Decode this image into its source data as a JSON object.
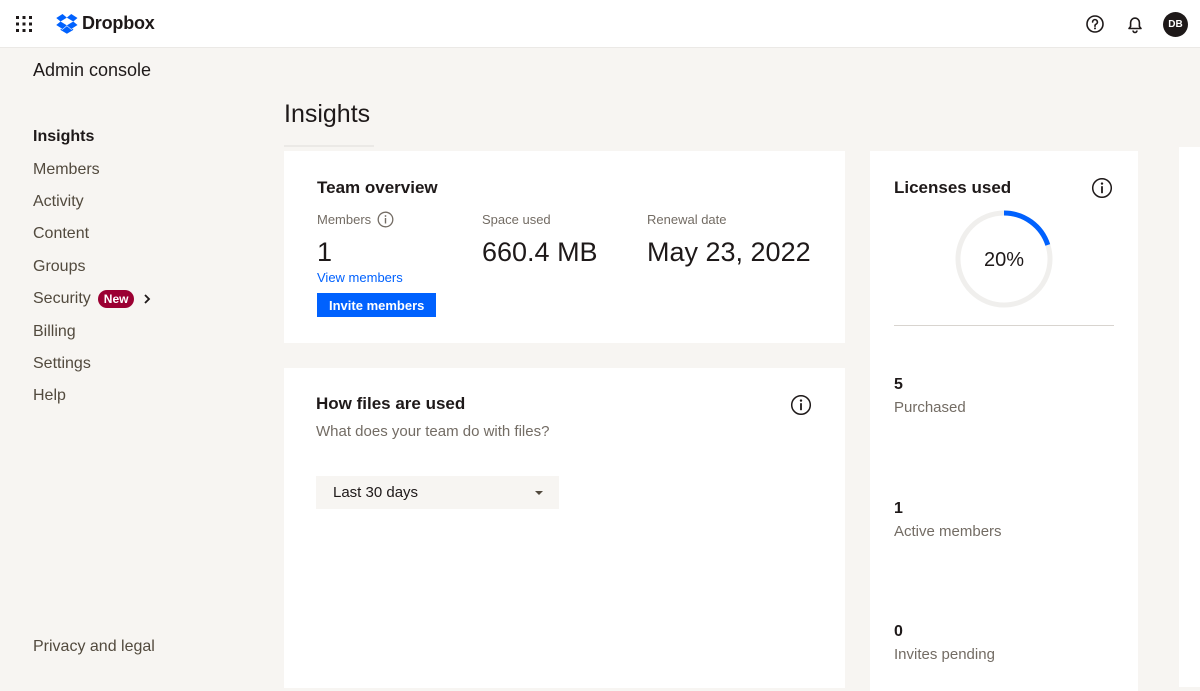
{
  "brand": {
    "name": "Dropbox",
    "color": "#0061fe"
  },
  "header": {
    "avatar_initials": "DB",
    "icons": [
      "apps-grid-icon",
      "help-icon",
      "bell-icon"
    ]
  },
  "sidebar": {
    "title": "Admin console",
    "items": [
      {
        "label": "Insights",
        "active": true
      },
      {
        "label": "Members"
      },
      {
        "label": "Activity"
      },
      {
        "label": "Content"
      },
      {
        "label": "Groups"
      },
      {
        "label": "Security",
        "badge": "New"
      },
      {
        "label": "Billing"
      },
      {
        "label": "Settings"
      },
      {
        "label": "Help"
      }
    ],
    "footer_link": "Privacy and legal"
  },
  "page": {
    "title": "Insights"
  },
  "team_overview": {
    "title": "Team overview",
    "members_label": "Members",
    "members_value": "1",
    "view_members_link": "View members",
    "invite_button": "Invite members",
    "space_label": "Space used",
    "space_value": "660.4 MB",
    "renewal_label": "Renewal date",
    "renewal_value": "May 23, 2022"
  },
  "files": {
    "title": "How files are used",
    "subtitle": "What does your team do with files?",
    "range_selected": "Last 30 days"
  },
  "licenses": {
    "title": "Licenses used",
    "percent_label": "20%",
    "percent_value": 0.2,
    "purchased_value": "5",
    "purchased_label": "Purchased",
    "active_value": "1",
    "active_label": "Active members",
    "pending_value": "0",
    "pending_label": "Invites pending"
  }
}
